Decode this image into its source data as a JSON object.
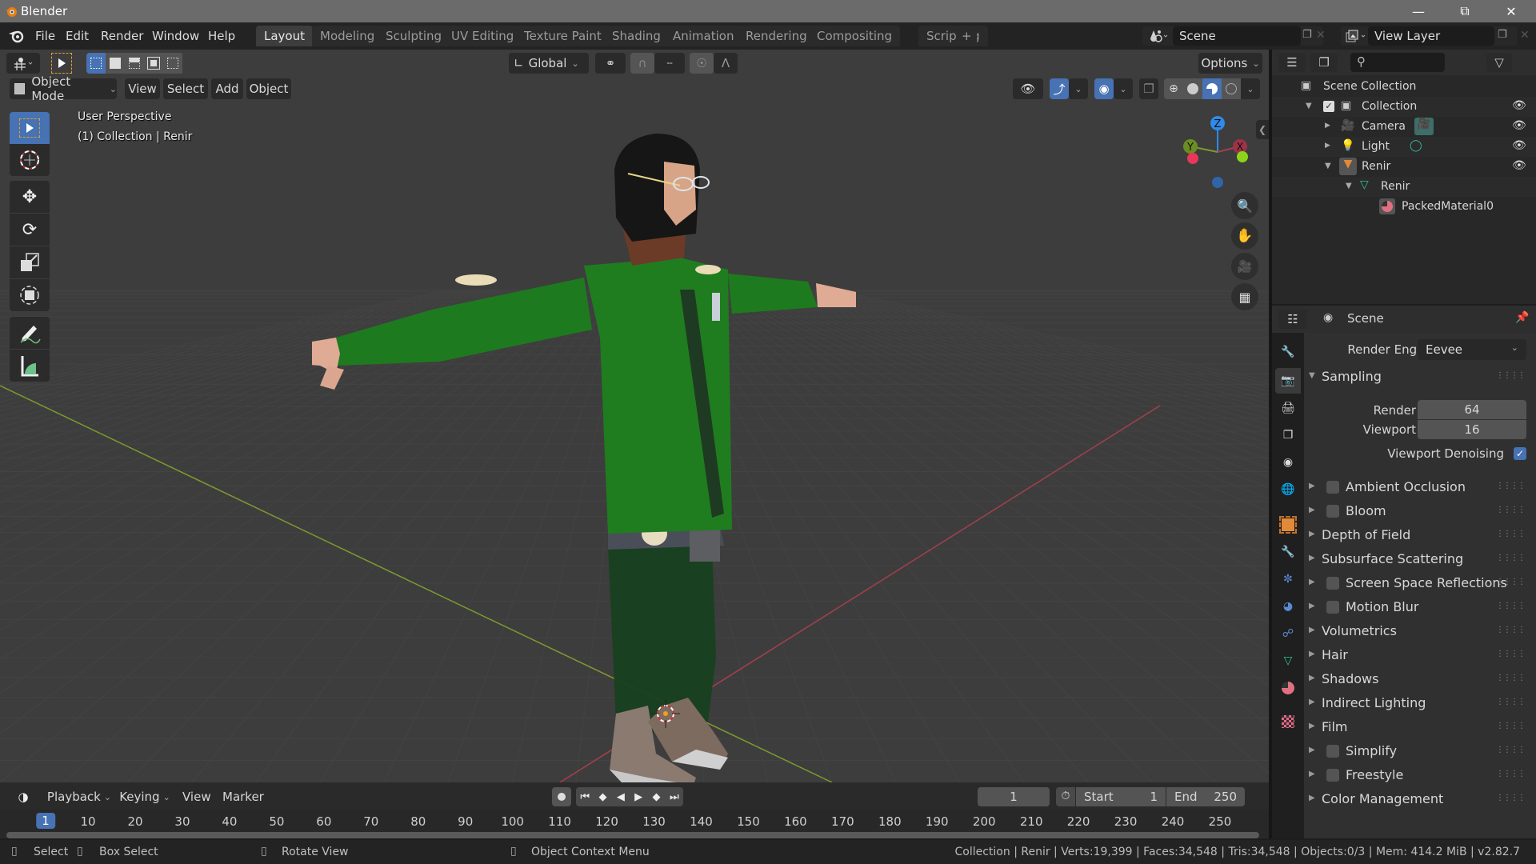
{
  "window": {
    "title": "Blender",
    "controls": [
      "minimize",
      "maximize",
      "close"
    ]
  },
  "menubar": {
    "items": [
      "File",
      "Edit",
      "Render",
      "Window",
      "Help"
    ]
  },
  "workspaces": {
    "tabs": [
      "Layout",
      "Modeling",
      "Sculpting",
      "UV Editing",
      "Texture Paint",
      "Shading",
      "Animation",
      "Rendering",
      "Compositing",
      "Scripting"
    ],
    "active": "Layout",
    "add_label": "+"
  },
  "scene_selector": {
    "value": "Scene"
  },
  "view_layer_selector": {
    "value": "View Layer"
  },
  "viewport_header": {
    "transform_orientation": "Global",
    "options_label": "Options",
    "mode": "Object Mode",
    "menus": [
      "View",
      "Select",
      "Add",
      "Object"
    ]
  },
  "viewport": {
    "perspective_label": "User Perspective",
    "context_label": "(1) Collection | Renir",
    "gizmo_axes": {
      "z": "Z",
      "y": "Y",
      "x": "X"
    },
    "colors": {
      "x_axis": "#c8475a",
      "y_axis": "#8cb33a",
      "z_axis": "#2f8ae8",
      "selected": "#4772b3"
    }
  },
  "toolbar": {
    "tools": [
      "select-box",
      "cursor",
      "move",
      "rotate",
      "scale",
      "transform",
      "annotate",
      "measure"
    ],
    "active": "select-box"
  },
  "nav_gizmos": [
    "zoom",
    "pan",
    "camera-view",
    "orthographic-toggle"
  ],
  "outliner": {
    "root": "Scene Collection",
    "items": [
      {
        "label": "Collection",
        "type": "collection",
        "depth": 1,
        "expanded": true,
        "checked": true,
        "visible": true
      },
      {
        "label": "Camera",
        "type": "camera",
        "depth": 2,
        "expanded": false,
        "visible": true
      },
      {
        "label": "Light",
        "type": "light",
        "depth": 2,
        "expanded": false,
        "visible": true
      },
      {
        "label": "Renir",
        "type": "mesh-object",
        "depth": 2,
        "expanded": true,
        "visible": true
      },
      {
        "label": "Renir",
        "type": "mesh-data",
        "depth": 3,
        "expanded": true
      },
      {
        "label": "PackedMaterial0",
        "type": "material",
        "depth": 4
      }
    ]
  },
  "properties": {
    "context": "Scene",
    "render_engine_label": "Render Engine",
    "render_engine": "Eevee",
    "sampling": {
      "title": "Sampling",
      "render_label": "Render",
      "render_value": "64",
      "viewport_label": "Viewport",
      "viewport_value": "16",
      "denoise_label": "Viewport Denoising",
      "denoise_checked": true
    },
    "panels": [
      {
        "label": "Ambient Occlusion",
        "checkbox": true,
        "checked": false
      },
      {
        "label": "Bloom",
        "checkbox": true,
        "checked": false
      },
      {
        "label": "Depth of Field",
        "checkbox": false
      },
      {
        "label": "Subsurface Scattering",
        "checkbox": false
      },
      {
        "label": "Screen Space Reflections",
        "checkbox": true,
        "checked": false
      },
      {
        "label": "Motion Blur",
        "checkbox": true,
        "checked": false
      },
      {
        "label": "Volumetrics",
        "checkbox": false
      },
      {
        "label": "Hair",
        "checkbox": false
      },
      {
        "label": "Shadows",
        "checkbox": false
      },
      {
        "label": "Indirect Lighting",
        "checkbox": false
      },
      {
        "label": "Film",
        "checkbox": false
      },
      {
        "label": "Simplify",
        "checkbox": true,
        "checked": false
      },
      {
        "label": "Freestyle",
        "checkbox": true,
        "checked": false
      },
      {
        "label": "Color Management",
        "checkbox": false
      }
    ],
    "tabs": [
      "tool",
      "render",
      "output",
      "view-layer",
      "scene",
      "world",
      "object",
      "modifiers",
      "particles",
      "physics",
      "constraints",
      "data",
      "material",
      "texture"
    ],
    "active_tab": "render"
  },
  "timeline": {
    "menus": [
      "Playback",
      "Keying",
      "View",
      "Marker"
    ],
    "current_frame": "1",
    "start_label": "Start",
    "start": "1",
    "end_label": "End",
    "end": "250",
    "ticks": [
      "1",
      "10",
      "20",
      "30",
      "40",
      "50",
      "60",
      "70",
      "80",
      "90",
      "100",
      "110",
      "120",
      "130",
      "140",
      "150",
      "160",
      "170",
      "180",
      "190",
      "200",
      "210",
      "220",
      "230",
      "240",
      "250"
    ]
  },
  "statusbar": {
    "left_hint": "Select",
    "middle_hint": "Box Select",
    "rotate_hint": "Rotate View",
    "context_hint": "Object Context Menu",
    "stats": "Collection | Renir | Verts:19,399 | Faces:34,548 | Tris:34,548 | Objects:0/3 | Mem: 414.2 MiB | v2.82.7"
  }
}
